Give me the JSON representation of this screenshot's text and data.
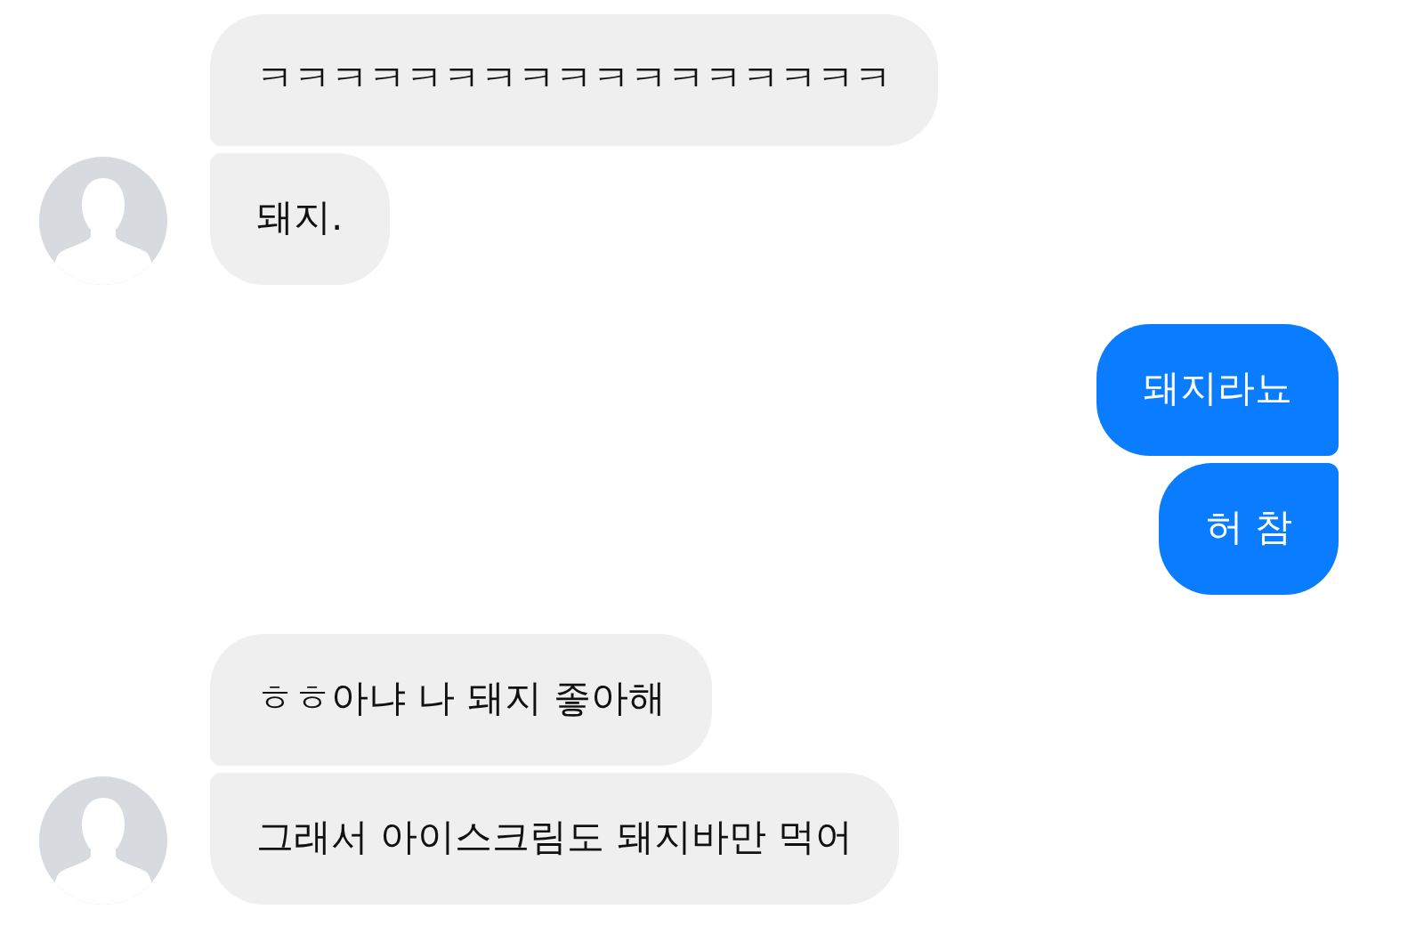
{
  "groups": [
    {
      "kind": "incoming",
      "messages": [
        "ㅋㅋㅋㅋㅋㅋㅋㅋㅋㅋㅋㅋㅋㅋㅋㅋㅋ",
        "돼지."
      ]
    },
    {
      "kind": "outgoing",
      "messages": [
        "돼지라뇨",
        "허 참"
      ]
    },
    {
      "kind": "incoming",
      "messages": [
        "ㅎㅎ아냐 나 돼지 좋아해",
        "그래서 아이스크림도 돼지바만 먹어"
      ]
    }
  ]
}
